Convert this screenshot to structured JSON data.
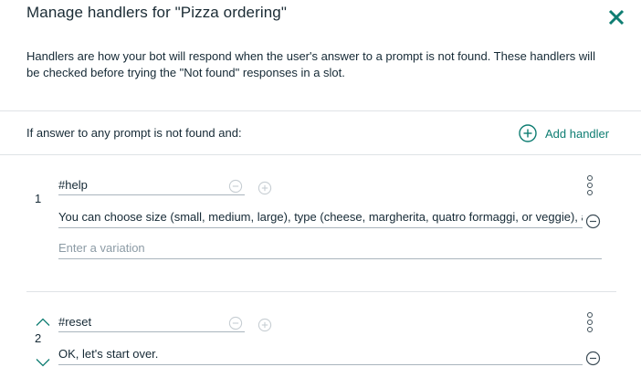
{
  "dialog": {
    "title": "Manage handlers for \"Pizza ordering\"",
    "description": "Handlers are how your bot will respond when the user's answer to a prompt is not found. These handlers will be checked before trying the \"Not found\" responses in a slot.",
    "condition_label": "If answer to any prompt is not found and:",
    "add_handler_label": "Add handler"
  },
  "handlers": [
    {
      "number": "1",
      "condition": "#help",
      "response": "You can choose size (small, medium, large), type (cheese, margherita, quatro formaggi, or veggie), and toppings.",
      "variation_placeholder": "Enter a variation"
    },
    {
      "number": "2",
      "condition": "#reset",
      "response": "OK, let's start over."
    }
  ],
  "colors": {
    "accent": "#0e7d72",
    "close": "#0e7d72",
    "text": "#152935",
    "border": "#aab5bd",
    "muted_icon": "#c7ced3"
  },
  "icons": {
    "close": "close-icon",
    "add": "plus-circle-icon",
    "remove": "minus-circle-icon",
    "more": "overflow-menu-icon",
    "move_up": "chevron-up-icon",
    "move_down": "chevron-down-icon"
  }
}
